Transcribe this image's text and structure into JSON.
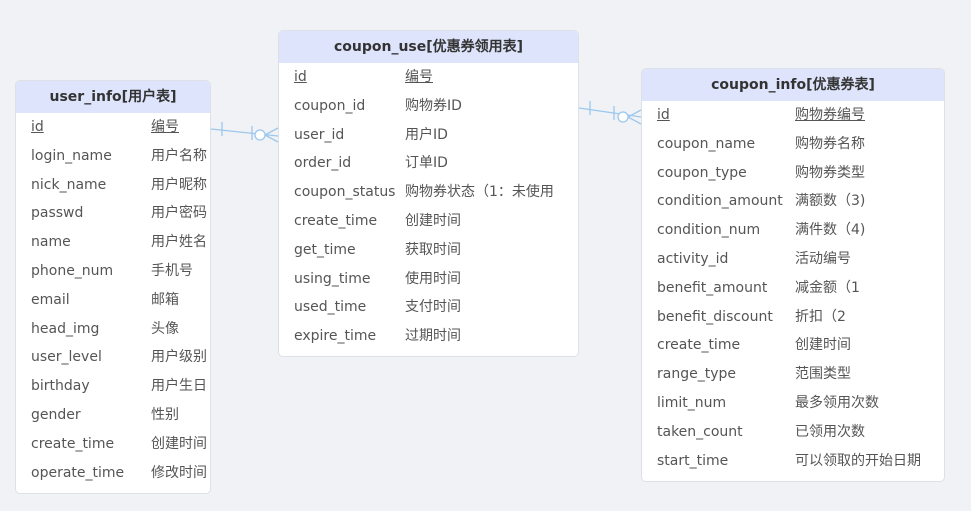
{
  "tables": {
    "user_info": {
      "title": "user_info[用户表]",
      "fields": [
        {
          "name": "id",
          "desc": "编号"
        },
        {
          "name": "login_name",
          "desc": "用户名称"
        },
        {
          "name": "nick_name",
          "desc": "用户昵称"
        },
        {
          "name": "passwd",
          "desc": "用户密码"
        },
        {
          "name": "name",
          "desc": "用户姓名"
        },
        {
          "name": "phone_num",
          "desc": "手机号"
        },
        {
          "name": "email",
          "desc": "邮箱"
        },
        {
          "name": "head_img",
          "desc": "头像"
        },
        {
          "name": "user_level",
          "desc": "用户级别"
        },
        {
          "name": "birthday",
          "desc": "用户生日"
        },
        {
          "name": "gender",
          "desc": "性别"
        },
        {
          "name": "create_time",
          "desc": "创建时间"
        },
        {
          "name": "operate_time",
          "desc": "修改时间"
        }
      ]
    },
    "coupon_use": {
      "title": "coupon_use[优惠券领用表]",
      "fields": [
        {
          "name": "id",
          "desc": "编号"
        },
        {
          "name": "coupon_id",
          "desc": "购物券ID"
        },
        {
          "name": "user_id",
          "desc": "用户ID"
        },
        {
          "name": "order_id",
          "desc": "订单ID"
        },
        {
          "name": "coupon_status",
          "desc": "购物券状态（1：未使用"
        },
        {
          "name": "create_time",
          "desc": "创建时间"
        },
        {
          "name": "get_time",
          "desc": "获取时间"
        },
        {
          "name": "using_time",
          "desc": "使用时间"
        },
        {
          "name": "used_time",
          "desc": "支付时间"
        },
        {
          "name": "expire_time",
          "desc": "过期时间"
        }
      ]
    },
    "coupon_info": {
      "title": "coupon_info[优惠券表]",
      "fields": [
        {
          "name": "id",
          "desc": "购物券编号"
        },
        {
          "name": "coupon_name",
          "desc": "购物券名称"
        },
        {
          "name": "coupon_type",
          "desc": "购物券类型"
        },
        {
          "name": "condition_amount",
          "desc": "满额数（3)"
        },
        {
          "name": "condition_num",
          "desc": "满件数（4)"
        },
        {
          "name": "activity_id",
          "desc": "活动编号"
        },
        {
          "name": "benefit_amount",
          "desc": "减金额（1"
        },
        {
          "name": "benefit_discount",
          "desc": "折扣（2"
        },
        {
          "name": "create_time",
          "desc": "创建时间"
        },
        {
          "name": "range_type",
          "desc": "范围类型"
        },
        {
          "name": "limit_num",
          "desc": "最多领用次数"
        },
        {
          "name": "taken_count",
          "desc": "已领用次数"
        },
        {
          "name": "start_time",
          "desc": "可以领取的开始日期"
        }
      ]
    }
  },
  "colors": {
    "header_bg": "#dee4fb",
    "connector": "#9cc7ee",
    "background": "#f0f2f5"
  }
}
